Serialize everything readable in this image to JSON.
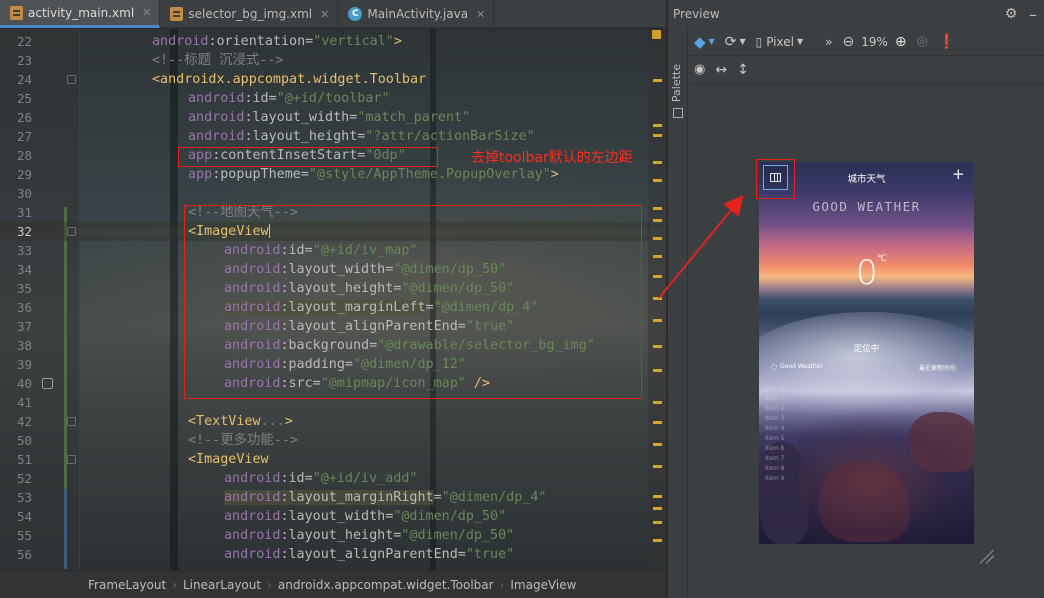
{
  "tabs": [
    {
      "label": "activity_main.xml",
      "type": "xml",
      "active": true
    },
    {
      "label": "selector_bg_img.xml",
      "type": "xml",
      "active": false
    },
    {
      "label": "MainActivity.java",
      "type": "java",
      "active": false
    }
  ],
  "code_lines": [
    {
      "n": "",
      "indent": 0,
      "parts": [
        [
          "ns",
          "android"
        ],
        [
          "attr",
          ":orientation="
        ],
        [
          "str",
          "\"vertical\""
        ],
        [
          "tag",
          ">"
        ]
      ],
      "partial": true
    },
    {
      "n": "22",
      "indent": 0,
      "parts": [
        [
          "ns",
          "android"
        ],
        [
          "attr",
          ":orientation="
        ],
        [
          "str",
          "\"vertical\""
        ],
        [
          "tag",
          ">"
        ]
      ]
    },
    {
      "n": "23",
      "indent": 0,
      "parts": [
        [
          "com",
          "<!--标题 沉浸式-->"
        ]
      ]
    },
    {
      "n": "24",
      "indent": 0,
      "parts": [
        [
          "tag",
          "<androidx.appcompat.widget.Toolbar"
        ]
      ]
    },
    {
      "n": "25",
      "indent": 1,
      "parts": [
        [
          "ns",
          "android"
        ],
        [
          "attr",
          ":id="
        ],
        [
          "str",
          "\"@+id/toolbar\""
        ]
      ]
    },
    {
      "n": "26",
      "indent": 1,
      "parts": [
        [
          "ns",
          "android"
        ],
        [
          "attr",
          ":layout_width="
        ],
        [
          "str",
          "\"match_parent\""
        ]
      ]
    },
    {
      "n": "27",
      "indent": 1,
      "parts": [
        [
          "ns",
          "android"
        ],
        [
          "attr",
          ":layout_height="
        ],
        [
          "str",
          "\"?attr/actionBarSize\""
        ]
      ]
    },
    {
      "n": "28",
      "indent": 1,
      "parts": [
        [
          "ns",
          "app"
        ],
        [
          "attr",
          ":contentInsetStart="
        ],
        [
          "str",
          "\"0dp\""
        ]
      ]
    },
    {
      "n": "29",
      "indent": 1,
      "parts": [
        [
          "ns",
          "app"
        ],
        [
          "attr",
          ":popupTheme="
        ],
        [
          "str",
          "\"@style/AppTheme.PopupOverlay\""
        ],
        [
          "tag",
          ">"
        ]
      ]
    },
    {
      "n": "30",
      "indent": 0,
      "parts": []
    },
    {
      "n": "31",
      "indent": 1,
      "parts": [
        [
          "com",
          "<!--地图天气-->"
        ]
      ]
    },
    {
      "n": "32",
      "indent": 1,
      "parts": [
        [
          "tag",
          "<ImageView"
        ]
      ],
      "current": true
    },
    {
      "n": "33",
      "indent": 2,
      "parts": [
        [
          "ns",
          "android"
        ],
        [
          "attr",
          ":id="
        ],
        [
          "str",
          "\"@+id/iv_map\""
        ]
      ]
    },
    {
      "n": "34",
      "indent": 2,
      "parts": [
        [
          "ns",
          "android"
        ],
        [
          "attr",
          ":layout_width="
        ],
        [
          "str",
          "\"@dimen/dp_50\""
        ]
      ]
    },
    {
      "n": "35",
      "indent": 2,
      "parts": [
        [
          "ns",
          "android"
        ],
        [
          "attr",
          ":layout_height="
        ],
        [
          "str",
          "\"@dimen/dp_50\""
        ]
      ]
    },
    {
      "n": "36",
      "indent": 2,
      "parts": [
        [
          "nsh",
          "android"
        ],
        [
          "attrh",
          ":layout_marginLeft"
        ],
        [
          "attr",
          "="
        ],
        [
          "str",
          "\"@dimen/dp_4\""
        ]
      ]
    },
    {
      "n": "37",
      "indent": 2,
      "parts": [
        [
          "ns",
          "android"
        ],
        [
          "attr",
          ":layout_alignParentEnd="
        ],
        [
          "str",
          "\"true\""
        ]
      ]
    },
    {
      "n": "38",
      "indent": 2,
      "parts": [
        [
          "ns",
          "android"
        ],
        [
          "attr",
          ":background="
        ],
        [
          "str",
          "\"@drawable/selector_bg_img\""
        ]
      ]
    },
    {
      "n": "39",
      "indent": 2,
      "parts": [
        [
          "ns",
          "android"
        ],
        [
          "attr",
          ":padding="
        ],
        [
          "str",
          "\"@dimen/dp_12\""
        ]
      ]
    },
    {
      "n": "40",
      "indent": 2,
      "parts": [
        [
          "ns",
          "android"
        ],
        [
          "attr",
          ":src="
        ],
        [
          "str",
          "\"@mipmap/icon_map\""
        ],
        [
          "tag",
          " />"
        ]
      ]
    },
    {
      "n": "41",
      "indent": 0,
      "parts": []
    },
    {
      "n": "42",
      "indent": 1,
      "parts": [
        [
          "tag",
          "<TextView"
        ],
        [
          "com",
          "..."
        ],
        [
          "tag",
          ">"
        ]
      ]
    },
    {
      "n": "50",
      "indent": 1,
      "parts": [
        [
          "com",
          "<!--更多功能-->"
        ]
      ]
    },
    {
      "n": "51",
      "indent": 1,
      "parts": [
        [
          "tag",
          "<ImageView"
        ]
      ]
    },
    {
      "n": "52",
      "indent": 2,
      "parts": [
        [
          "ns",
          "android"
        ],
        [
          "attr",
          ":id="
        ],
        [
          "str",
          "\"@+id/iv_add\""
        ]
      ]
    },
    {
      "n": "53",
      "indent": 2,
      "parts": [
        [
          "nsh",
          "android"
        ],
        [
          "attrh",
          ":layout_marginRight"
        ],
        [
          "attr",
          "="
        ],
        [
          "str",
          "\"@dimen/dp_4\""
        ]
      ]
    },
    {
      "n": "54",
      "indent": 2,
      "parts": [
        [
          "ns",
          "android"
        ],
        [
          "attr",
          ":layout_width="
        ],
        [
          "str",
          "\"@dimen/dp_50\""
        ]
      ]
    },
    {
      "n": "55",
      "indent": 2,
      "parts": [
        [
          "ns",
          "android"
        ],
        [
          "attr",
          ":layout_height="
        ],
        [
          "str",
          "\"@dimen/dp_50\""
        ]
      ]
    },
    {
      "n": "56",
      "indent": 2,
      "parts": [
        [
          "ns",
          "android"
        ],
        [
          "attr",
          ":layout_alignParentEnd="
        ],
        [
          "str",
          "\"true\""
        ]
      ]
    }
  ],
  "annotation_text": "去掉toolbar默认的左边距",
  "breadcrumb": [
    "FrameLayout",
    "LinearLayout",
    "androidx.appcompat.widget.Toolbar",
    "ImageView"
  ],
  "preview": {
    "title": "Preview",
    "palette_label": "Palette",
    "device": "Pixel",
    "zoom": "19%",
    "phone": {
      "title": "城市天气",
      "add_symbol": "+",
      "headline": "GOOD WEATHER",
      "temperature": "0",
      "unit": "℃",
      "location": "定位中",
      "weather": "Good Weather",
      "update": "最近更新时间:",
      "items": [
        "Item 0",
        "Item 1",
        "Item 2",
        "Item 3",
        "Item 4",
        "Item 5",
        "Item 6",
        "Item 7",
        "Item 8",
        "Item 9"
      ]
    }
  },
  "colors": {
    "annotation": "#e0241c",
    "accent": "#4a88c7"
  }
}
